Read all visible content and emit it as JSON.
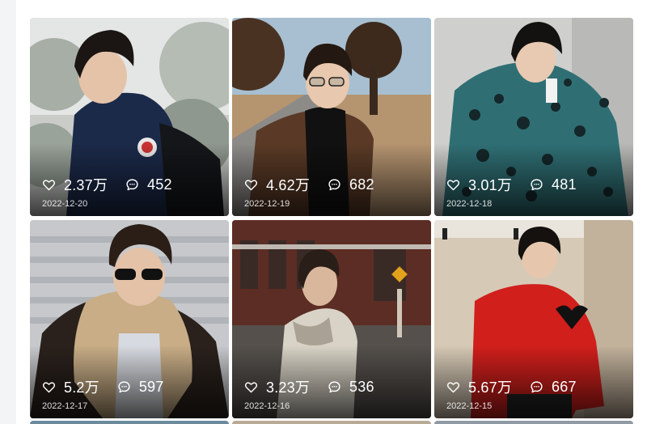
{
  "posts": [
    {
      "likes": "2.37万",
      "comments": "452",
      "date": "2022-12-20"
    },
    {
      "likes": "4.62万",
      "comments": "682",
      "date": "2022-12-19"
    },
    {
      "likes": "3.01万",
      "comments": "481",
      "date": "2022-12-18"
    },
    {
      "likes": "5.2万",
      "comments": "597",
      "date": "2022-12-17"
    },
    {
      "likes": "3.23万",
      "comments": "536",
      "date": "2022-12-16"
    },
    {
      "likes": "5.67万",
      "comments": "667",
      "date": "2022-12-15"
    }
  ],
  "icons": {
    "like": "heart-icon",
    "comment": "comment-bubble-icon"
  },
  "colors": {
    "overlay_text": "#ffffff",
    "page_background": "#f3f4f6"
  }
}
